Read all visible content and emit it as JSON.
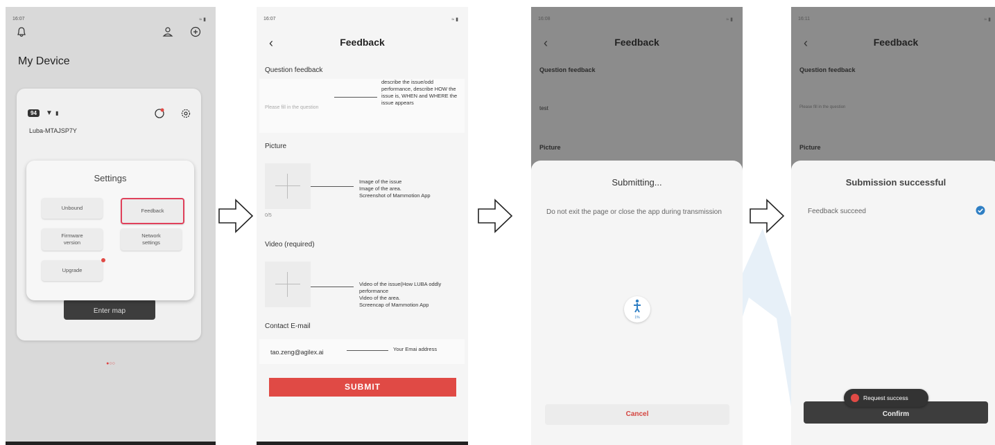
{
  "screen1": {
    "time": "16:07",
    "status": "≈ ▮",
    "title": "My Device",
    "badge": "94",
    "device_name": "Luba-MTAJSP7Y",
    "settings_title": "Settings",
    "buttons": {
      "unbound": "Unbound",
      "feedback": "Feedback",
      "firmware": "Firmware version",
      "network": "Network settings",
      "upgrade": "Upgrade"
    },
    "enter_map": "Enter map",
    "page_dots": "●○○"
  },
  "screen2": {
    "time": "16:07",
    "status": "≈ ▮",
    "title": "Feedback",
    "question_label": "Question feedback",
    "question_placeholder": "Please fill in the question",
    "question_note": "describe the issue/odd performance, describe HOW the issue is, WHEN and WHERE the issue appears",
    "picture_label": "Picture",
    "picture_note": "Image of the issue\nImage of the area.\nScreenshot of Mammotion App",
    "picture_count": "0/5",
    "video_label": "Video (required)",
    "video_note": "Video of the issue(How LUBA oddly performance\nVideo of the area.\nScreencap of Mammotion App",
    "email_label": "Contact E-mail",
    "email_value": "tao.zeng@agilex.ai",
    "email_note": "Your Emai address",
    "submit": "SUBMIT"
  },
  "screen3": {
    "time": "16:08",
    "status": "≈ ▮",
    "title": "Feedback",
    "question_label": "Question feedback",
    "question_value": "test",
    "picture_label": "Picture",
    "dialog_title": "Submitting...",
    "dialog_text": "Do not exit the page or close the app during transmission",
    "progress_text": "1%",
    "cancel": "Cancel"
  },
  "screen4": {
    "time": "16:11",
    "status": "≈ ▮",
    "title": "Feedback",
    "question_label": "Question feedback",
    "question_placeholder": "Please fill in the question",
    "picture_label": "Picture",
    "dialog_title": "Submission successful",
    "success_text": "Feedback succeed",
    "toast": "Request success",
    "confirm": "Confirm"
  },
  "colors": {
    "accent_red": "#e04a45",
    "highlight_red": "#e0405a",
    "check_blue": "#2f7fc4",
    "watermark_blue": "#3a82c8"
  }
}
